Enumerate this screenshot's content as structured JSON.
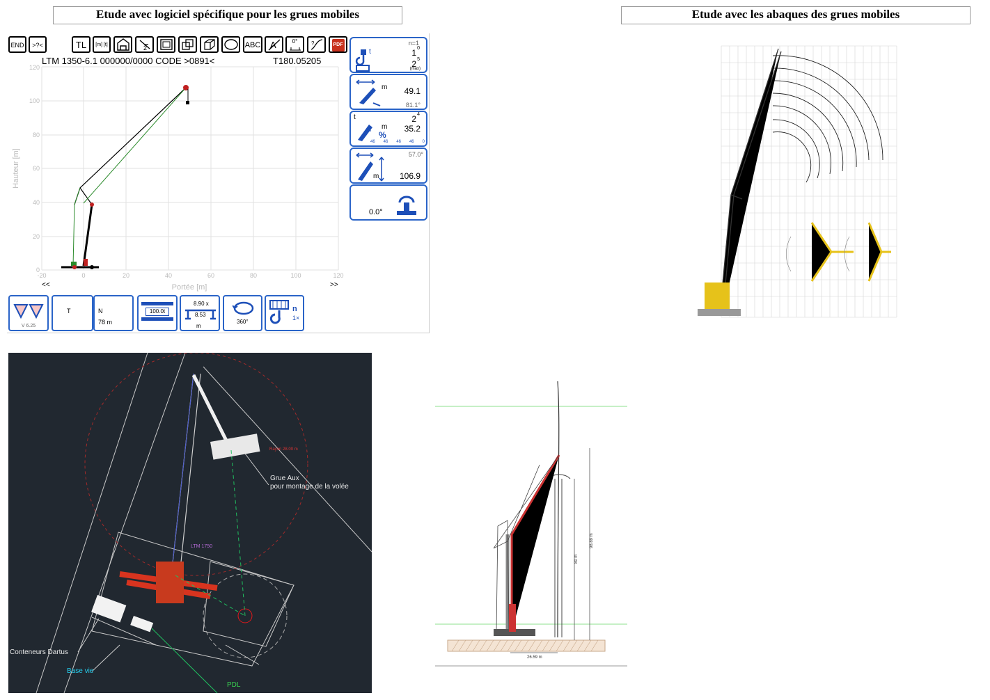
{
  "titles": {
    "left": "Etude avec logiciel spécifique pour les grues mobiles",
    "right": "Etude avec les abaques des grues mobiles"
  },
  "toolbar": {
    "end": "END",
    "help": ">?<",
    "tl": "TL",
    "units": "[m] [t]",
    "abc": "ABC",
    "zero_deg": "0°",
    "pdf": "PDF"
  },
  "crane_sw": {
    "header": "LTM 1350-6.1   000000/0000    CODE >0891<",
    "code_right": "T180.05205",
    "y_axis_label": "Hauteur [m]",
    "x_axis_label": "Portée [m]",
    "y_ticks": [
      "0",
      "20",
      "40",
      "60",
      "80",
      "100",
      "120"
    ],
    "x_ticks": [
      "-20",
      "0",
      "20",
      "40",
      "60",
      "80",
      "100",
      "120"
    ],
    "nav_left": "<<",
    "nav_right": ">>"
  },
  "right_panel": {
    "n_label": "n=1",
    "load_unit": "t",
    "load_1": "1",
    "load_1_sup": "0",
    "load_2": "2",
    "load_2_sup": "5",
    "load_2_note": "(max)",
    "radius_unit": "m",
    "radius_value": "49.1",
    "radius_angle": "81.1°",
    "cap_unit_t": "t",
    "cap_unit_m": "m",
    "cap_unit_pct": "%",
    "cap_value_top": "2",
    "cap_value_top_sup": "4",
    "cap_value": "35.2",
    "cap_scale": [
      "46",
      "46",
      "46",
      "46",
      "0"
    ],
    "height_angle": "57.0°",
    "height_unit": "m",
    "height_value": "106.9",
    "slew_value": "0.0°"
  },
  "bottom_bar": {
    "version": "V 6.25",
    "t_label": "T",
    "n_label": "N",
    "m_value": "78 m",
    "counterweight": "100.0t",
    "outrigger_1": "8.90 x",
    "outrigger_2": "8.53",
    "outrigger_unit": "m",
    "slew_range": "360°",
    "reeving_n": "n",
    "reeving_val": "1×"
  },
  "cad_plan": {
    "label_aux": "Grue Aux",
    "label_aux2": "pour montage de la volée",
    "label_ltm": "LTM 1750",
    "label_containers": "Conteneurs Dartus",
    "label_base": "Base vie",
    "label_pdl": "PDL",
    "label_radius": "Rayon 28.00 m"
  },
  "elevation": {
    "dim_height": "98.89 m",
    "dim_80": "80 m",
    "dim_radius": "26.59 m"
  },
  "colors": {
    "accent_blue": "#2a64c8",
    "cad_bg": "#212830",
    "crane_red": "#d8341f",
    "crane_yellow": "#e6c21a"
  }
}
